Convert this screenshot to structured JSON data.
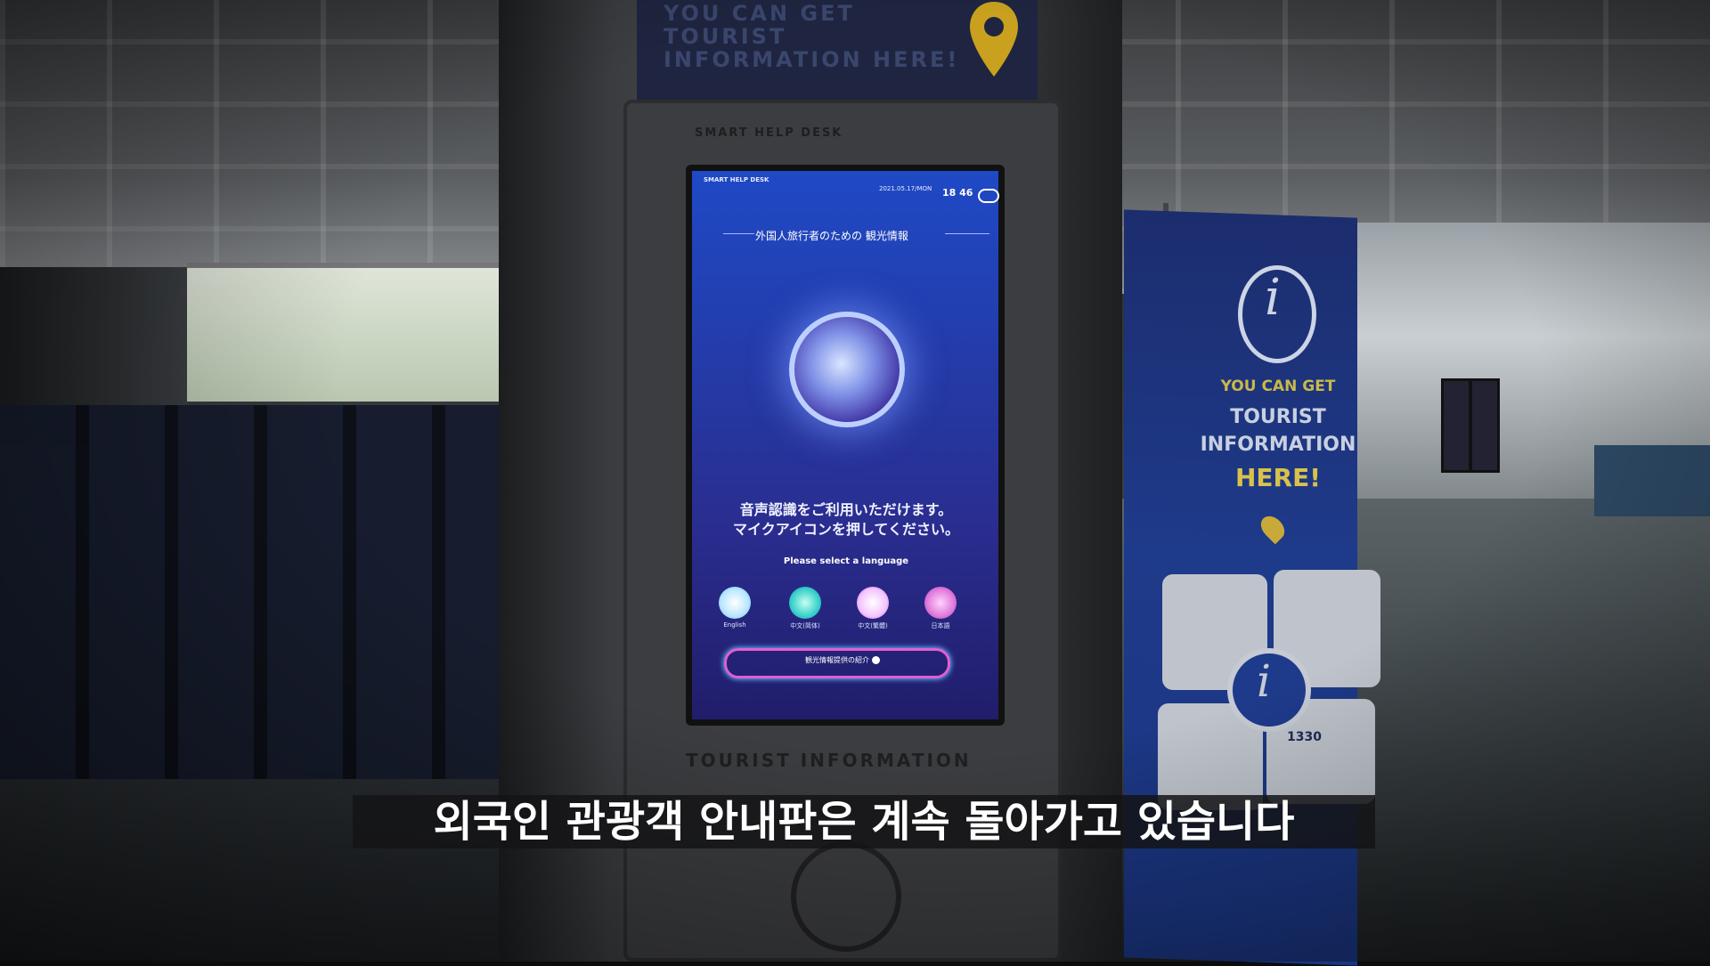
{
  "kiosk": {
    "top_banner_text": "YOU CAN GET TOURIST INFORMATION HERE!",
    "device_label": "SMART HELP DESK",
    "bottom_label": "TOURIST INFORMATION"
  },
  "screen": {
    "top_left_label": "SMART HELP DESK",
    "date": "2021.05.17/MON",
    "time": "18 46",
    "header_title": "外国人旅行者のための 観光情報",
    "voice_message_line1": "音声認識をご利用いただけます。",
    "voice_message_line2": "マイクアイコンを押してください。",
    "language_prompt": "Please select a language",
    "languages": [
      "English",
      "中文(简体)",
      "中文(繁體)",
      "日本語"
    ],
    "info_button_label": "観光情報提供の紹介"
  },
  "banner": {
    "icon_letter": "i",
    "line1": "YOU CAN GET",
    "line2": "TOURIST",
    "line3": "INFORMATION",
    "line4": "HERE!",
    "panel_number": "1330"
  },
  "subtitle": "외국인 관광객 안내판은 계속 돌아가고 있습니다"
}
